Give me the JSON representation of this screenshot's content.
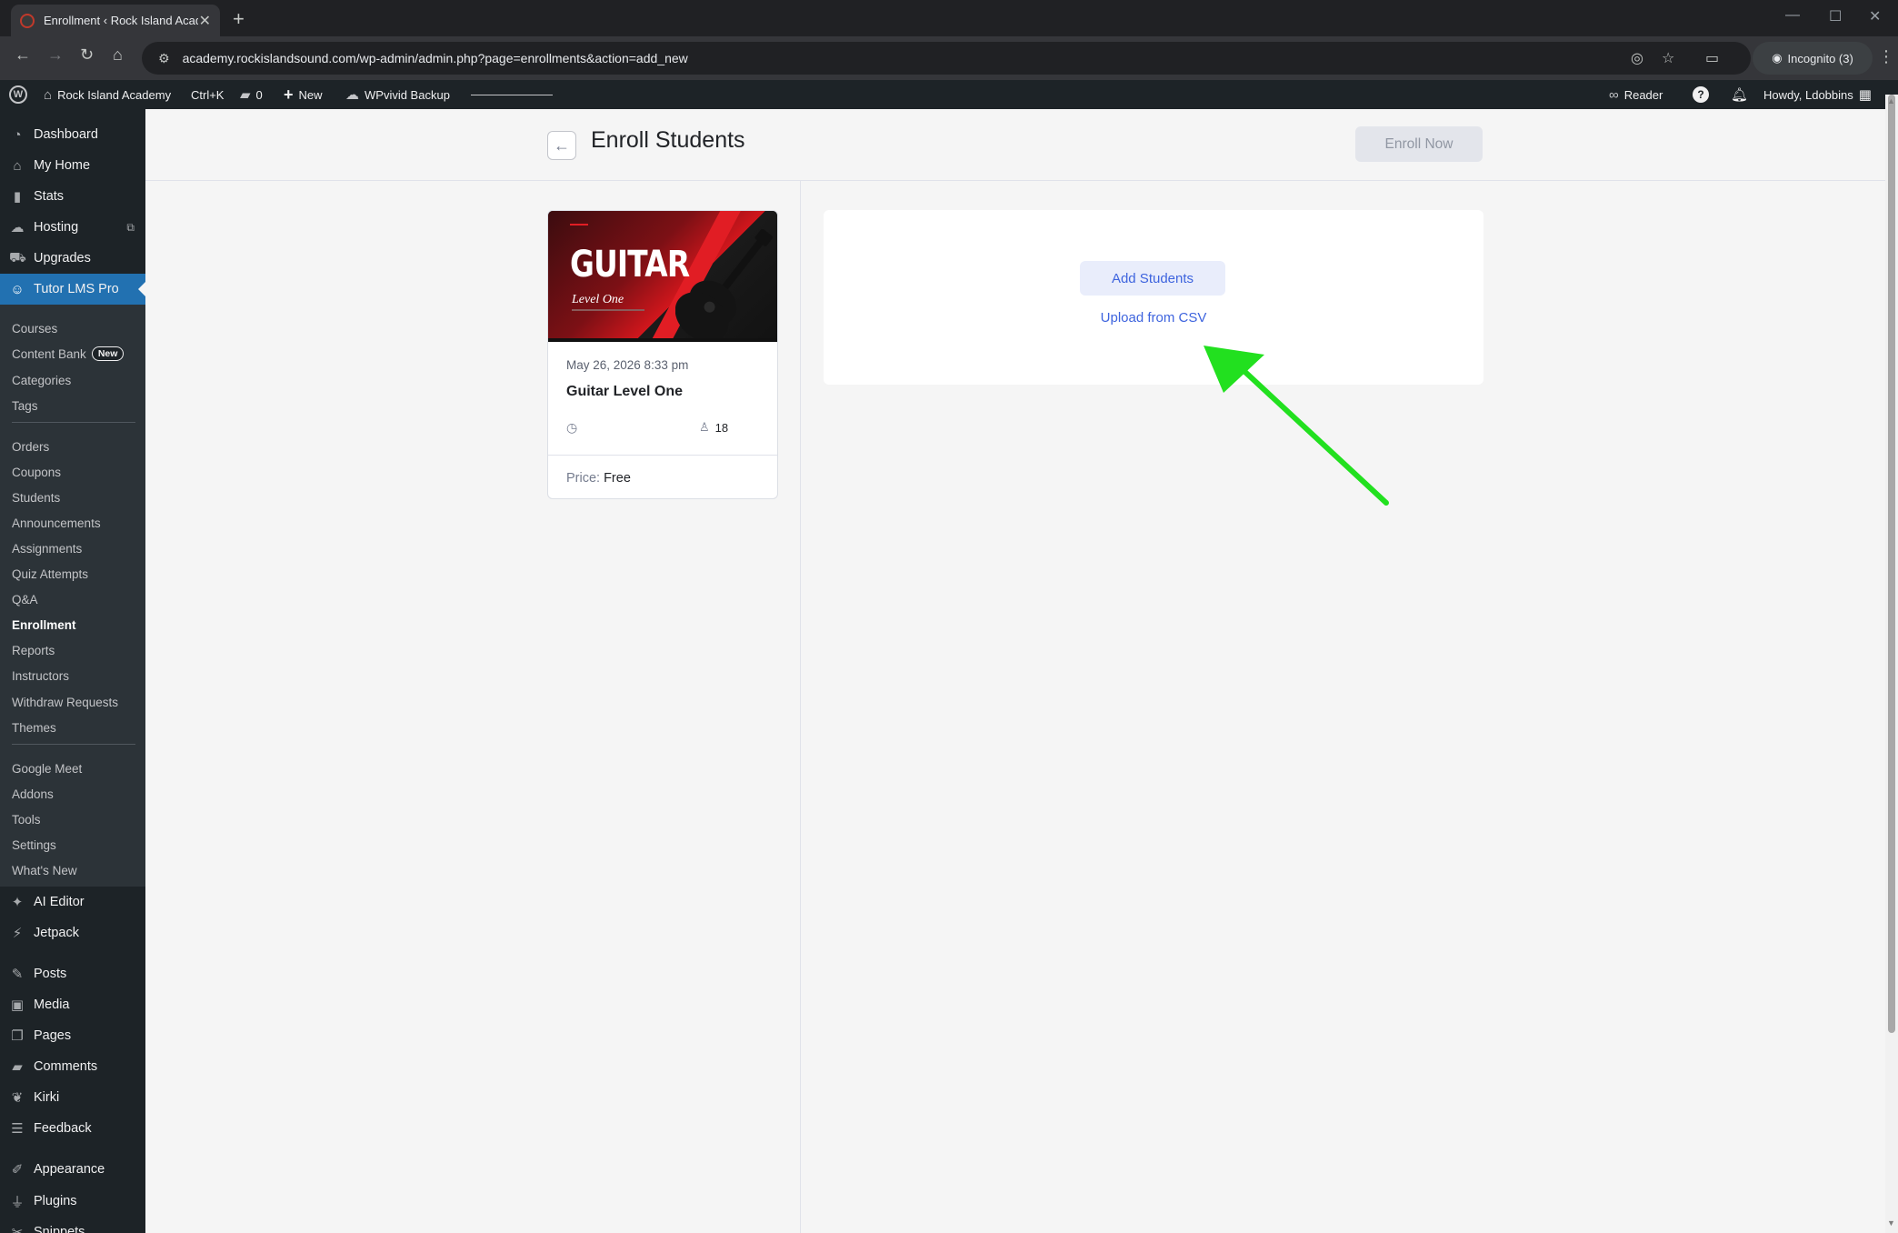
{
  "browser": {
    "tab_title": "Enrollment ‹ Rock Island Acade",
    "url": "academy.rockislandsound.com/wp-admin/admin.php?page=enrollments&action=add_new",
    "incognito_label": "Incognito (3)"
  },
  "adminbar": {
    "site_name": "Rock Island Academy",
    "shortcut": "Ctrl+K",
    "comments_count": "0",
    "new_label": "New",
    "backup_label": "WPvivid Backup",
    "reader_label": "Reader",
    "howdy": "Howdy, Ldobbins"
  },
  "sidebar": {
    "top_items": [
      {
        "label": "Dashboard",
        "icon": "dashboard-icon"
      },
      {
        "label": "My Home",
        "icon": "home-icon"
      },
      {
        "label": "Stats",
        "icon": "stats-icon"
      },
      {
        "label": "Hosting",
        "icon": "cloud-icon"
      },
      {
        "label": "Upgrades",
        "icon": "cart-icon"
      },
      {
        "label": "Tutor LMS Pro",
        "icon": "tutor-icon"
      }
    ],
    "sub_group_1": [
      "Courses",
      "Content Bank",
      "Categories",
      "Tags"
    ],
    "content_bank_badge": "New",
    "sub_group_2": [
      "Orders",
      "Coupons",
      "Students",
      "Announcements",
      "Assignments",
      "Quiz Attempts",
      "Q&A",
      "Enrollment",
      "Reports",
      "Instructors",
      "Withdraw Requests",
      "Themes"
    ],
    "sub_group_3": [
      "Google Meet",
      "Addons",
      "Tools",
      "Settings",
      "What's New"
    ],
    "bottom_items": [
      {
        "label": "AI Editor",
        "icon": "sparkle-icon"
      },
      {
        "label": "Jetpack",
        "icon": "jetpack-icon"
      },
      {
        "label": "Posts",
        "icon": "pin-icon"
      },
      {
        "label": "Media",
        "icon": "media-icon"
      },
      {
        "label": "Pages",
        "icon": "pages-icon"
      },
      {
        "label": "Comments",
        "icon": "comment-icon"
      },
      {
        "label": "Kirki",
        "icon": "kirki-icon"
      },
      {
        "label": "Feedback",
        "icon": "feedback-icon"
      },
      {
        "label": "Appearance",
        "icon": "brush-icon"
      },
      {
        "label": "Plugins",
        "icon": "plug-icon"
      },
      {
        "label": "Snippets",
        "icon": "scissors-icon"
      }
    ]
  },
  "page": {
    "title": "Enroll Students",
    "enroll_now": "Enroll Now"
  },
  "course": {
    "thumb_title": "GUITAR",
    "thumb_subtitle": "Level One",
    "date": "May 26, 2026 8:33 pm",
    "name": "Guitar Level One",
    "students": "18",
    "price_label": "Price:",
    "price_value": "Free"
  },
  "actions": {
    "add_students": "Add Students",
    "upload_csv": "Upload from CSV"
  },
  "colors": {
    "wp_dark": "#1d2327",
    "wp_blue": "#2271b1",
    "tutor_blue": "#3e64de",
    "annotation_green": "#22e01f"
  }
}
